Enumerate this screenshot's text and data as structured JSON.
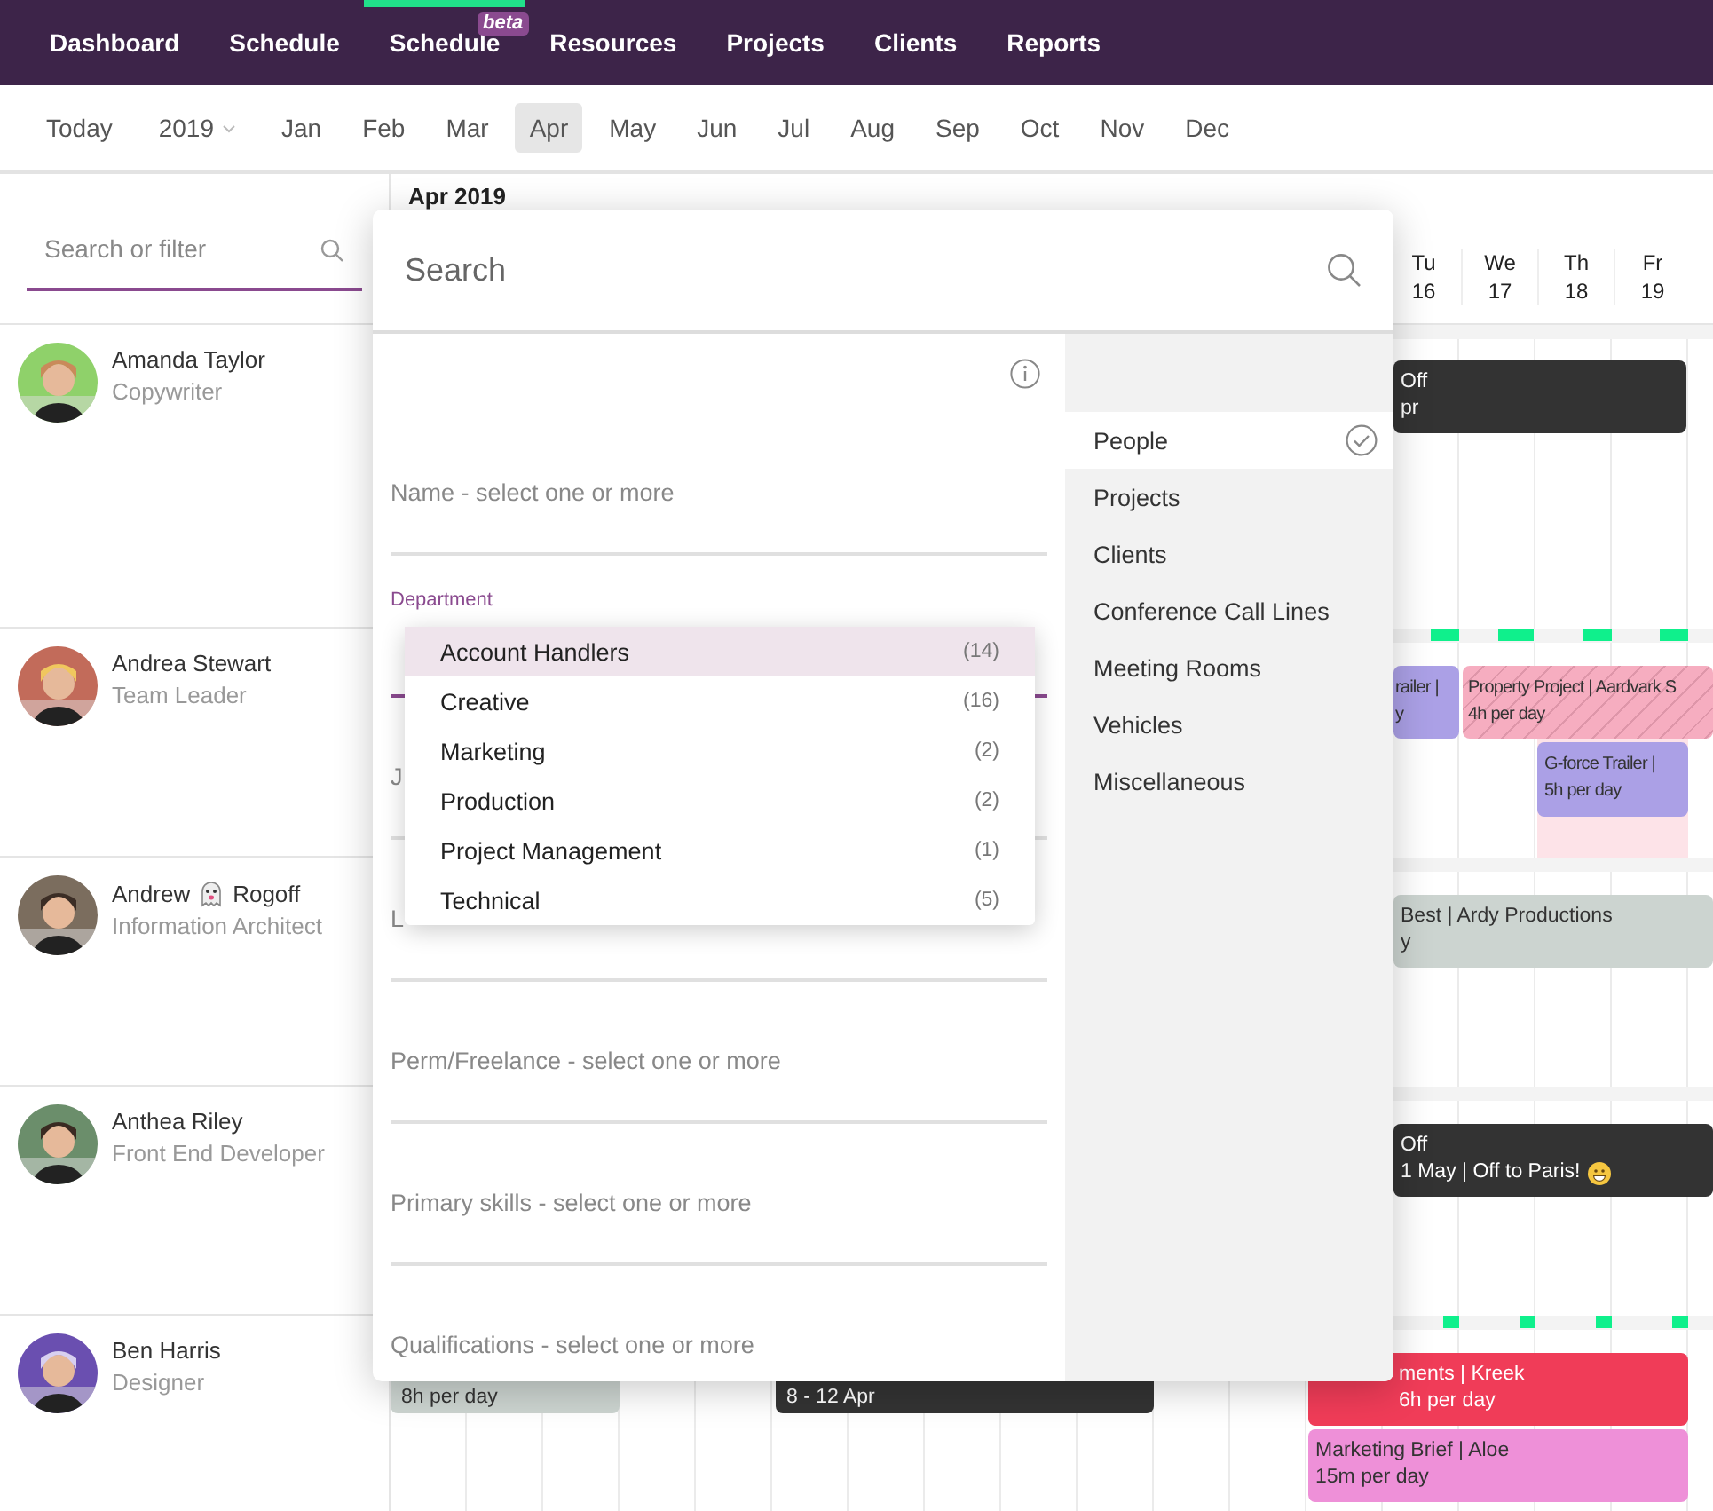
{
  "nav": {
    "items": [
      {
        "label": "Dashboard",
        "selected": false
      },
      {
        "label": "Schedule",
        "selected": false
      },
      {
        "label": "Schedule",
        "selected": true,
        "badge": "beta"
      },
      {
        "label": "Resources",
        "selected": false
      },
      {
        "label": "Projects",
        "selected": false
      },
      {
        "label": "Clients",
        "selected": false
      },
      {
        "label": "Reports",
        "selected": false
      }
    ]
  },
  "months": {
    "today": "Today",
    "year": "2019",
    "items": [
      {
        "label": "Jan",
        "selected": false
      },
      {
        "label": "Feb",
        "selected": false
      },
      {
        "label": "Mar",
        "selected": false
      },
      {
        "label": "Apr",
        "selected": true
      },
      {
        "label": "May",
        "selected": false
      },
      {
        "label": "Jun",
        "selected": false
      },
      {
        "label": "Jul",
        "selected": false
      },
      {
        "label": "Aug",
        "selected": false
      },
      {
        "label": "Sep",
        "selected": false
      },
      {
        "label": "Oct",
        "selected": false
      },
      {
        "label": "Nov",
        "selected": false
      },
      {
        "label": "Dec",
        "selected": false
      }
    ]
  },
  "sidebar": {
    "search": {
      "placeholder": "Search or filter"
    },
    "people": [
      {
        "name": "Amanda Taylor",
        "role": "Copywriter"
      },
      {
        "name": "Andrea Stewart",
        "role": "Team Leader"
      },
      {
        "name": "Andrew",
        "name_after": "Rogoff",
        "role": "Information Architect"
      },
      {
        "name": "Anthea Riley",
        "role": "Front End Developer"
      },
      {
        "name": "Ben Harris",
        "role": "Designer"
      }
    ]
  },
  "calendar": {
    "month": "Apr 2019",
    "days": [
      {
        "weekday": "Tu",
        "date": "16"
      },
      {
        "weekday": "We",
        "date": "17"
      },
      {
        "weekday": "Th",
        "date": "18"
      },
      {
        "weekday": "Fr",
        "date": "19"
      }
    ],
    "rows": [
      {
        "events": [
          {
            "lines": [
              "Off",
              "pr"
            ],
            "color": "#333333"
          }
        ]
      },
      {
        "events": [
          {
            "lines": [
              "railer |",
              "y"
            ],
            "color": "#aba0e6"
          },
          {
            "lines": [
              "Property Project | Aardvark S",
              "4h per day"
            ],
            "color": "#f6adc0",
            "hatched": true
          },
          {
            "lines": [
              "G-force Trailer |",
              "5h per day"
            ],
            "color": "#aba0e6"
          }
        ]
      },
      {
        "events": [
          {
            "lines": [
              "Best | Ardy Productions",
              "y"
            ],
            "color": "#ccd4d0"
          }
        ]
      },
      {
        "events": [
          {
            "lines": [
              "Off",
              "1 May | Off to Paris!"
            ],
            "color": "#333333"
          }
        ]
      },
      {
        "events": [
          {
            "lines": [
              "8h per day"
            ],
            "color": "#ccd4d0"
          },
          {
            "lines": [
              "8 - 12 Apr"
            ],
            "color": "#333333"
          },
          {
            "lines": [
              "ments | Kreek",
              "6h per day"
            ],
            "color": "#f03c58"
          },
          {
            "lines": [
              "Marketing Brief | Aloe",
              "15m per day"
            ],
            "color": "#ee90d8"
          }
        ]
      }
    ]
  },
  "panel": {
    "search": {
      "placeholder": "Search"
    },
    "fields": [
      {
        "kind": "placeholder",
        "text": "Name - select one or more"
      },
      {
        "kind": "label",
        "text": "Department"
      },
      {
        "kind": "placeholder",
        "text": "J"
      },
      {
        "kind": "placeholder",
        "text": "L"
      },
      {
        "kind": "placeholder",
        "text": "Perm/Freelance - select one or more"
      },
      {
        "kind": "placeholder",
        "text": "Primary skills - select one or more"
      },
      {
        "kind": "placeholder",
        "text": "Qualifications - select one or more"
      }
    ],
    "dropdown": [
      {
        "label": "Account Handlers",
        "count": "(14)",
        "selected": true
      },
      {
        "label": "Creative",
        "count": "(16)",
        "selected": false
      },
      {
        "label": "Marketing",
        "count": "(2)",
        "selected": false
      },
      {
        "label": "Production",
        "count": "(2)",
        "selected": false
      },
      {
        "label": "Project Management",
        "count": "(1)",
        "selected": false
      },
      {
        "label": "Technical",
        "count": "(5)",
        "selected": false
      }
    ],
    "categories": [
      {
        "label": "People",
        "selected": true
      },
      {
        "label": "Projects",
        "selected": false
      },
      {
        "label": "Clients",
        "selected": false
      },
      {
        "label": "Conference Call Lines",
        "selected": false
      },
      {
        "label": "Meeting Rooms",
        "selected": false
      },
      {
        "label": "Vehicles",
        "selected": false
      },
      {
        "label": "Miscellaneous",
        "selected": false
      }
    ]
  }
}
